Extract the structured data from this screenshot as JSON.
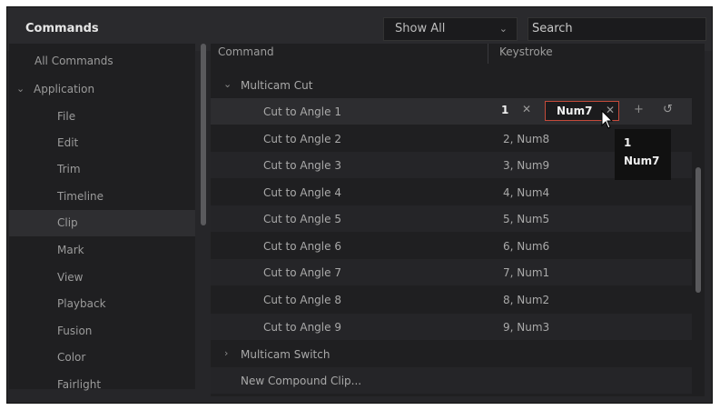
{
  "header": {
    "title": "Commands",
    "filter": {
      "value": "Show All",
      "icon": "chevron-down-icon"
    },
    "search": {
      "value": "Search"
    }
  },
  "sidebar": {
    "items": [
      {
        "label": "All Commands",
        "level": 0
      },
      {
        "label": "Application",
        "level": 0,
        "expanded": true,
        "icon": "chevron-down-icon"
      },
      {
        "label": "File",
        "level": 1
      },
      {
        "label": "Edit",
        "level": 1
      },
      {
        "label": "Trim",
        "level": 1
      },
      {
        "label": "Timeline",
        "level": 1
      },
      {
        "label": "Clip",
        "level": 1,
        "selected": true
      },
      {
        "label": "Mark",
        "level": 1
      },
      {
        "label": "View",
        "level": 1
      },
      {
        "label": "Playback",
        "level": 1
      },
      {
        "label": "Fusion",
        "level": 1
      },
      {
        "label": "Color",
        "level": 1
      },
      {
        "label": "Fairlight",
        "level": 1
      }
    ]
  },
  "table": {
    "columns": [
      "Command",
      "Keystroke"
    ],
    "groups": {
      "multicam_cut": {
        "label": "Multicam Cut",
        "expanded": true,
        "icon": "chevron-down-icon"
      },
      "multicam_switch": {
        "label": "Multicam Switch",
        "expanded": false,
        "icon": "chevron-right-icon"
      }
    },
    "editing_row": {
      "command": "Cut to Angle 1",
      "key1": "1",
      "key2": "Num7",
      "remove_icon": "close-icon",
      "add_icon": "plus-icon",
      "reset_icon": "reset-icon"
    },
    "rows": [
      {
        "command": "Cut to Angle 2",
        "keystroke": "2, Num8"
      },
      {
        "command": "Cut to Angle 3",
        "keystroke": "3, Num9"
      },
      {
        "command": "Cut to Angle 4",
        "keystroke": "4, Num4"
      },
      {
        "command": "Cut to Angle 5",
        "keystroke": "5, Num5"
      },
      {
        "command": "Cut to Angle 6",
        "keystroke": "6, Num6"
      },
      {
        "command": "Cut to Angle 7",
        "keystroke": "7, Num1"
      },
      {
        "command": "Cut to Angle 8",
        "keystroke": "8, Num2"
      },
      {
        "command": "Cut to Angle 9",
        "keystroke": "9, Num3"
      }
    ],
    "last_row": {
      "command": "New Compound Clip..."
    }
  },
  "tooltip": {
    "line1": "1",
    "line2": "Num7"
  }
}
